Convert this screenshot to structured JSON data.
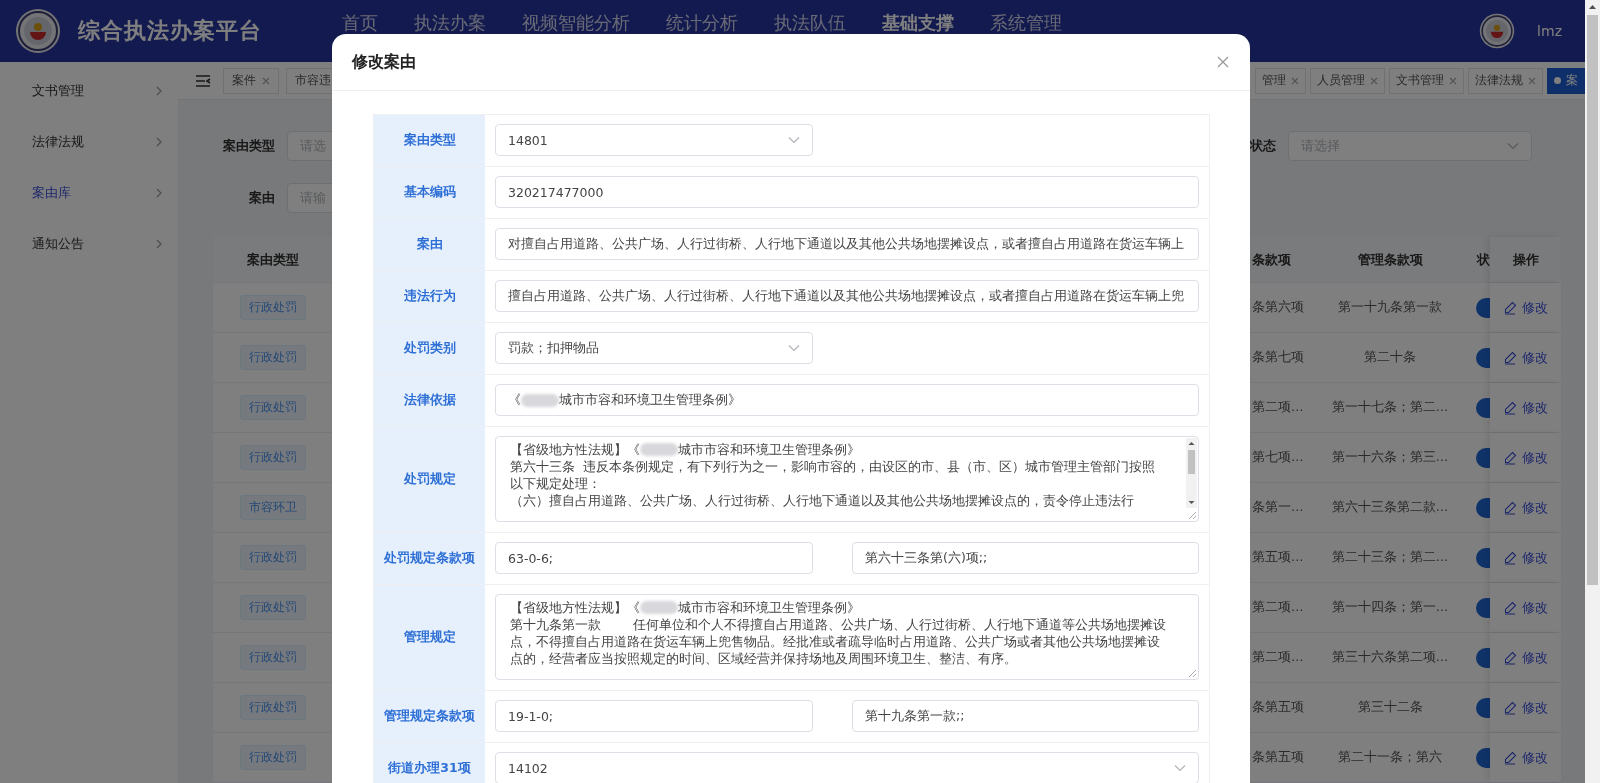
{
  "header": {
    "title": "综合执法办案平台",
    "user": "lmz",
    "nav": [
      {
        "label": "首页",
        "selected": false
      },
      {
        "label": "执法办案",
        "selected": false
      },
      {
        "label": "视频智能分析",
        "selected": false
      },
      {
        "label": "统计分析",
        "selected": false
      },
      {
        "label": "执法队伍",
        "selected": false
      },
      {
        "label": "基础支撑",
        "selected": true
      },
      {
        "label": "系统管理",
        "selected": false
      }
    ]
  },
  "sidebar": {
    "items": [
      {
        "label": "文书管理",
        "selected": false
      },
      {
        "label": "法律法规",
        "selected": false
      },
      {
        "label": "案由库",
        "selected": true
      },
      {
        "label": "通知公告",
        "selected": false
      }
    ]
  },
  "tabs_left": [
    {
      "label": "案件",
      "selected": false,
      "closable": true
    },
    {
      "label": "市容违",
      "selected": false,
      "closable": false
    }
  ],
  "tabs_right": [
    {
      "label": "管理",
      "selected": false,
      "closable": true
    },
    {
      "label": "人员管理",
      "selected": false,
      "closable": true
    },
    {
      "label": "文书管理",
      "selected": false,
      "closable": true
    },
    {
      "label": "法律法规",
      "selected": false,
      "closable": true
    },
    {
      "label": "案",
      "selected": true,
      "closable": false
    }
  ],
  "filters": [
    {
      "label": "案由类型",
      "kind": "input",
      "placeholder": "请选"
    },
    {
      "label": "案由",
      "kind": "input",
      "placeholder": "请输"
    },
    {
      "label": "状态",
      "kind": "select",
      "placeholder": "请选择"
    }
  ],
  "table": {
    "columns": [
      "案由类型",
      "条款项",
      "管理条款项",
      "状",
      "操作"
    ],
    "rows": [
      {
        "type": "行政处罚",
        "column_2": "条第六项",
        "management_clause": "第一十九条第一款",
        "enabled": true,
        "action": "修改"
      },
      {
        "type": "行政处罚",
        "column_2": "条第七项",
        "management_clause": "第二十条",
        "enabled": true,
        "action": "修改"
      },
      {
        "type": "行政处罚",
        "column_2": "第二项…",
        "management_clause": "第一十七条；第二…",
        "enabled": true,
        "action": "修改"
      },
      {
        "type": "行政处罚",
        "column_2": "第七项…",
        "management_clause": "第一十六条；第三…",
        "enabled": true,
        "action": "修改"
      },
      {
        "type": "市容环卫",
        "column_2": "条第一…",
        "management_clause": "第六十三条第二款…",
        "enabled": true,
        "action": "修改"
      },
      {
        "type": "行政处罚",
        "column_2": "第五项…",
        "management_clause": "第二十三条；第二…",
        "enabled": true,
        "action": "修改"
      },
      {
        "type": "行政处罚",
        "column_2": "第二项…",
        "management_clause": "第一十四条；第一…",
        "enabled": true,
        "action": "修改"
      },
      {
        "type": "行政处罚",
        "column_2": "第二项…",
        "management_clause": "第三十六条第二项…",
        "enabled": true,
        "action": "修改"
      },
      {
        "type": "行政处罚",
        "column_2": "条第五项",
        "management_clause": "第三十二条",
        "enabled": true,
        "action": "修改"
      },
      {
        "type": "行政处罚",
        "column_2": "条第五项",
        "management_clause": "第二十一条；第六",
        "enabled": true,
        "action": "修改"
      }
    ]
  },
  "dialog": {
    "title": "修改案由",
    "fields": [
      {
        "label": "案由类型",
        "kind": "select",
        "value": "14801"
      },
      {
        "label": "基本编码",
        "kind": "input",
        "value": "320217477000"
      },
      {
        "label": "案由",
        "kind": "input",
        "value": "对擅自占用道路、公共广场、人行过街桥、人行地下通道以及其他公共场地摆摊设点，或者擅自占用道路在货运车辆上"
      },
      {
        "label": "违法行为",
        "kind": "input",
        "value": "擅自占用道路、公共广场、人行过街桥、人行地下通道以及其他公共场地摆摊设点，或者擅自占用道路在货运车辆上兜"
      },
      {
        "label": "处罚类别",
        "kind": "select",
        "value": "罚款；扣押物品"
      },
      {
        "label": "法律依据",
        "kind": "redacted_input",
        "parts": [
          "《",
          "城市市容和环境卫生管理条例》"
        ]
      },
      {
        "label": "处罚规定",
        "kind": "scroll_textarea",
        "lines": [
          [
            "【省级地方性法规】《",
            "城市市容和环境卫生管理条例》"
          ],
          [
            "第六十三条  违反本条例规定，有下列行为之一，影响市容的，由设区的市、县（市、区）城市管理主管部门按照"
          ],
          [
            "以下规定处理："
          ],
          [
            "（六）擅自占用道路、公共广场、人行过街桥、人行地下通道以及其他公共场地摆摊设点的，责令停止违法行"
          ]
        ]
      },
      {
        "label": "处罚规定条款项",
        "kind": "pair",
        "values": [
          "63-0-6;",
          "第六十三条第(六)项;;"
        ]
      },
      {
        "label": "管理规定",
        "kind": "textarea",
        "lines": [
          [
            "【省级地方性法规】《",
            "城市市容和环境卫生管理条例》"
          ],
          [
            "第十九条第一款        任何单位和个人不得擅自占用道路、公共广场、人行过街桥、人行地下通道等公共场地摆摊设"
          ],
          [
            "点，不得擅自占用道路在货运车辆上兜售物品。经批准或者疏导临时占用道路、公共广场或者其他公共场地摆摊设"
          ],
          [
            "点的，经营者应当按照规定的时间、区域经营并保持场地及周围环境卫生、整洁、有序。"
          ]
        ]
      },
      {
        "label": "管理规定条款项",
        "kind": "pair",
        "values": [
          "19-1-0;",
          "第十九条第一款;;"
        ]
      },
      {
        "label": "街道办理31项",
        "kind": "wide_select",
        "value": "14102"
      }
    ]
  }
}
